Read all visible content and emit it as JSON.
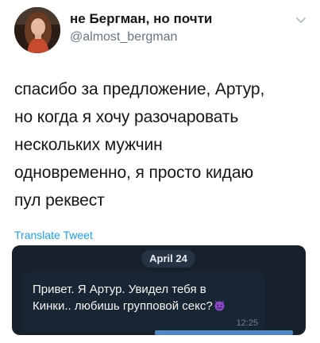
{
  "user": {
    "display_name": "не Бергман, но почти",
    "handle": "@almost_bergman"
  },
  "tweet": {
    "text": "спасибо за предложение, Артур,\nно когда я хочу разочаровать\nнескольких мужчин\nодновременно, я просто кидаю\nпул реквест",
    "translate_label": "Translate Tweet"
  },
  "media": {
    "date": "April 24",
    "message": "Привет. Я Артур. Увидел тебя в\nКинки.. любишь групповой секс?",
    "message_emoji": "smiling-imp-emoji",
    "time": "12:25"
  },
  "icons": {
    "caret": "chevron-down-icon"
  },
  "colors": {
    "link": "#1da1f2",
    "chat_background": "#17212b",
    "bubble": "#182533",
    "date_pill": "#263343",
    "emoji": "#8a48c8"
  }
}
